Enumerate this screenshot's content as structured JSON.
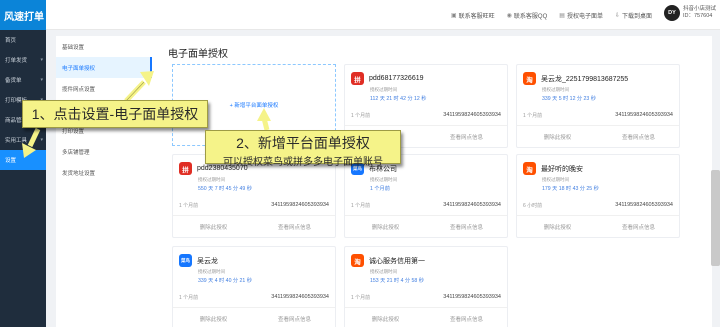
{
  "brand": "风速打单",
  "nav": [
    {
      "label": "首页",
      "chev": "",
      "state": ""
    },
    {
      "label": "打单发货",
      "chev": "▾",
      "state": ""
    },
    {
      "label": "备货单",
      "chev": "▾",
      "state": ""
    },
    {
      "label": "打印模板",
      "chev": "▾",
      "state": ""
    },
    {
      "label": "商品管理",
      "chev": "▾",
      "state": ""
    },
    {
      "label": "实用工具",
      "chev": "▾",
      "state": ""
    },
    {
      "label": "设置",
      "chev": "",
      "state": "active"
    }
  ],
  "topbar": {
    "links": [
      {
        "icon": "▣",
        "label": "联系客服旺旺"
      },
      {
        "icon": "◉",
        "label": "联系客服QQ"
      },
      {
        "icon": "▤",
        "label": "授权电子面单"
      },
      {
        "icon": "⇩",
        "label": "下载到桌面"
      }
    ],
    "avatar": "DY",
    "user_name": "抖音小店测试",
    "user_id": "ID：757604"
  },
  "subnav": [
    {
      "label": "基础设置",
      "state": ""
    },
    {
      "label": "电子面单授权",
      "state": "active"
    },
    {
      "label": "揽件网点设置",
      "state": ""
    },
    {
      "label": "",
      "state": ""
    },
    {
      "label": "打印设置",
      "state": ""
    },
    {
      "label": "多店铺管理",
      "state": ""
    },
    {
      "label": "发货地址设置",
      "state": ""
    }
  ],
  "main": {
    "title": "电子面单授权",
    "add_button": "+ 新增平台面单授权"
  },
  "cards": [
    {
      "logo": "拼",
      "kind": "pdd",
      "name": "pdd68177326619",
      "label": "授权过期时间",
      "time": "112 天 21 时 42 分 12 秒",
      "ago": "1 个月前",
      "id": "341195982460539393​4",
      "del": "删除此授权",
      "view": "查看网点信息"
    },
    {
      "logo": "淘",
      "kind": "tb",
      "name": "吴云龙_2251799813687255",
      "label": "授权过期时间",
      "time": "339 天 5 时 12 分 23 秒",
      "ago": "1 个月前",
      "id": "341195982460539393​4",
      "del": "删除此授权",
      "view": "查看网点信息"
    },
    {
      "logo": "拼",
      "kind": "pdd",
      "name": "pdd2380435070",
      "label": "授权过期时间",
      "time": "550 天 7 时 45 分 49 秒",
      "ago": "1 个月前",
      "id": "341195982460539393​4",
      "del": "删除此授权",
      "view": "查看网点信息"
    },
    {
      "logo": "菜鸟",
      "kind": "cn",
      "name": "布林公司",
      "label": "授权过期时间",
      "time": "1 个月前",
      "ago": "1 个月前",
      "id": "341195982460539393​4",
      "del": "删除此授权",
      "view": "查看网点信息"
    },
    {
      "logo": "淘",
      "kind": "tb",
      "name": "最好听的晚安",
      "label": "授权过期时间",
      "time": "179 天 18 时 43 分 25 秒",
      "ago": "6 小时前",
      "id": "341195982460539393​4",
      "del": "删除此授权",
      "view": "查看网点信息"
    },
    {
      "logo": "菜鸟",
      "kind": "cn",
      "name": "吴云龙",
      "label": "授权过期时间",
      "time": "339 天 4 时 40 分 21 秒",
      "ago": "1 个月前",
      "id": "341195982460539393​4",
      "del": "删除此授权",
      "view": "查看网点信息"
    },
    {
      "logo": "淘",
      "kind": "tb",
      "name": "诚心服务信用第一",
      "label": "授权过期时间",
      "time": "153 天 21 时 4 分 58 秒",
      "ago": "1 个月前",
      "id": "341195982460539393​4",
      "del": "删除此授权",
      "view": "查看网点信息"
    }
  ],
  "callouts": {
    "step1": "1、点击设置-电子面单授权",
    "step2_title": "2、新增平台面单授权",
    "step2_desc": "可以授权菜鸟或拼多多电子面单账号"
  }
}
